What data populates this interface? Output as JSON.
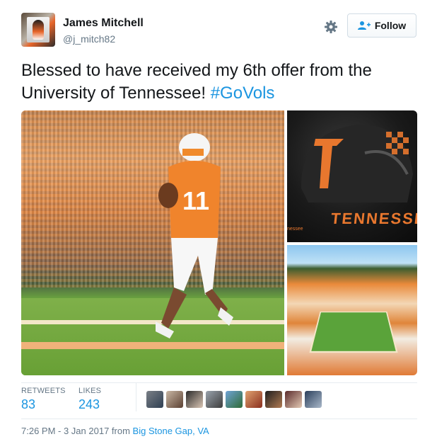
{
  "author": {
    "name": "James Mitchell",
    "handle": "@j_mitch82"
  },
  "actions": {
    "follow_label": "Follow",
    "settings_icon": "gear-icon",
    "follow_icon": "add-user-icon"
  },
  "tweet": {
    "text": "Blessed to have received my 6th offer from the University of Tennessee! ",
    "hashtag": "#GoVols"
  },
  "media": {
    "main_jersey_number": "11",
    "helmet_brand": "TENNESSEE",
    "helmet_small_text": "nessee"
  },
  "stats": {
    "retweets_label": "RETWEETS",
    "retweets_value": "83",
    "likes_label": "LIKES",
    "likes_value": "243"
  },
  "likers_count_shown": 9,
  "meta": {
    "timestamp": "7:26 PM - 3 Jan 2017",
    "from_text": " from ",
    "location": "Big Stone Gap, VA"
  },
  "colors": {
    "link": "#1b95e0",
    "text": "#14171a",
    "muted": "#657786",
    "tennessee_orange": "#e8772e"
  }
}
